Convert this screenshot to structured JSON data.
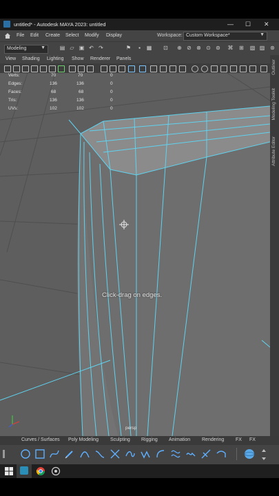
{
  "window": {
    "title": "untitled* - Autodesk MAYA 2023: untitled",
    "minimize_glyph": "—",
    "maximize_glyph": "☐",
    "close_glyph": "✕"
  },
  "menubar": {
    "items": [
      "File",
      "Edit",
      "Create",
      "Select",
      "Modify",
      "Display"
    ],
    "workspace_label": "Workspace:",
    "workspace_value": "Custom Workspace*"
  },
  "toolbar": {
    "mode": "Modeling"
  },
  "panel_menu": {
    "items": [
      "View",
      "Shading",
      "Lighting",
      "Show",
      "Renderer",
      "Panels"
    ]
  },
  "hud": {
    "rows": [
      {
        "label": "Verts:",
        "v1": "70",
        "v2": "70",
        "v3": "0"
      },
      {
        "label": "Edges:",
        "v1": "136",
        "v2": "136",
        "v3": "0"
      },
      {
        "label": "Faces:",
        "v1": "68",
        "v2": "68",
        "v3": "0"
      },
      {
        "label": "Tris:",
        "v1": "136",
        "v2": "136",
        "v3": "0"
      },
      {
        "label": "UVs:",
        "v1": "102",
        "v2": "102",
        "v3": "0"
      }
    ]
  },
  "viewport": {
    "hint": "Click-drag on edges.",
    "camera": "persp",
    "wire_color": "#5fd3f0",
    "background_color": "#5e5e5e"
  },
  "side_tabs": [
    "Outliner",
    "Modeling Toolkit",
    "Attribute Editor"
  ],
  "shelf": {
    "tabs": [
      "Curves / Surfaces",
      "Poly Modeling",
      "Sculpting",
      "Rigging",
      "Animation",
      "Rendering",
      "FX",
      "FX"
    ],
    "active_tab": "Curves / Surfaces"
  }
}
